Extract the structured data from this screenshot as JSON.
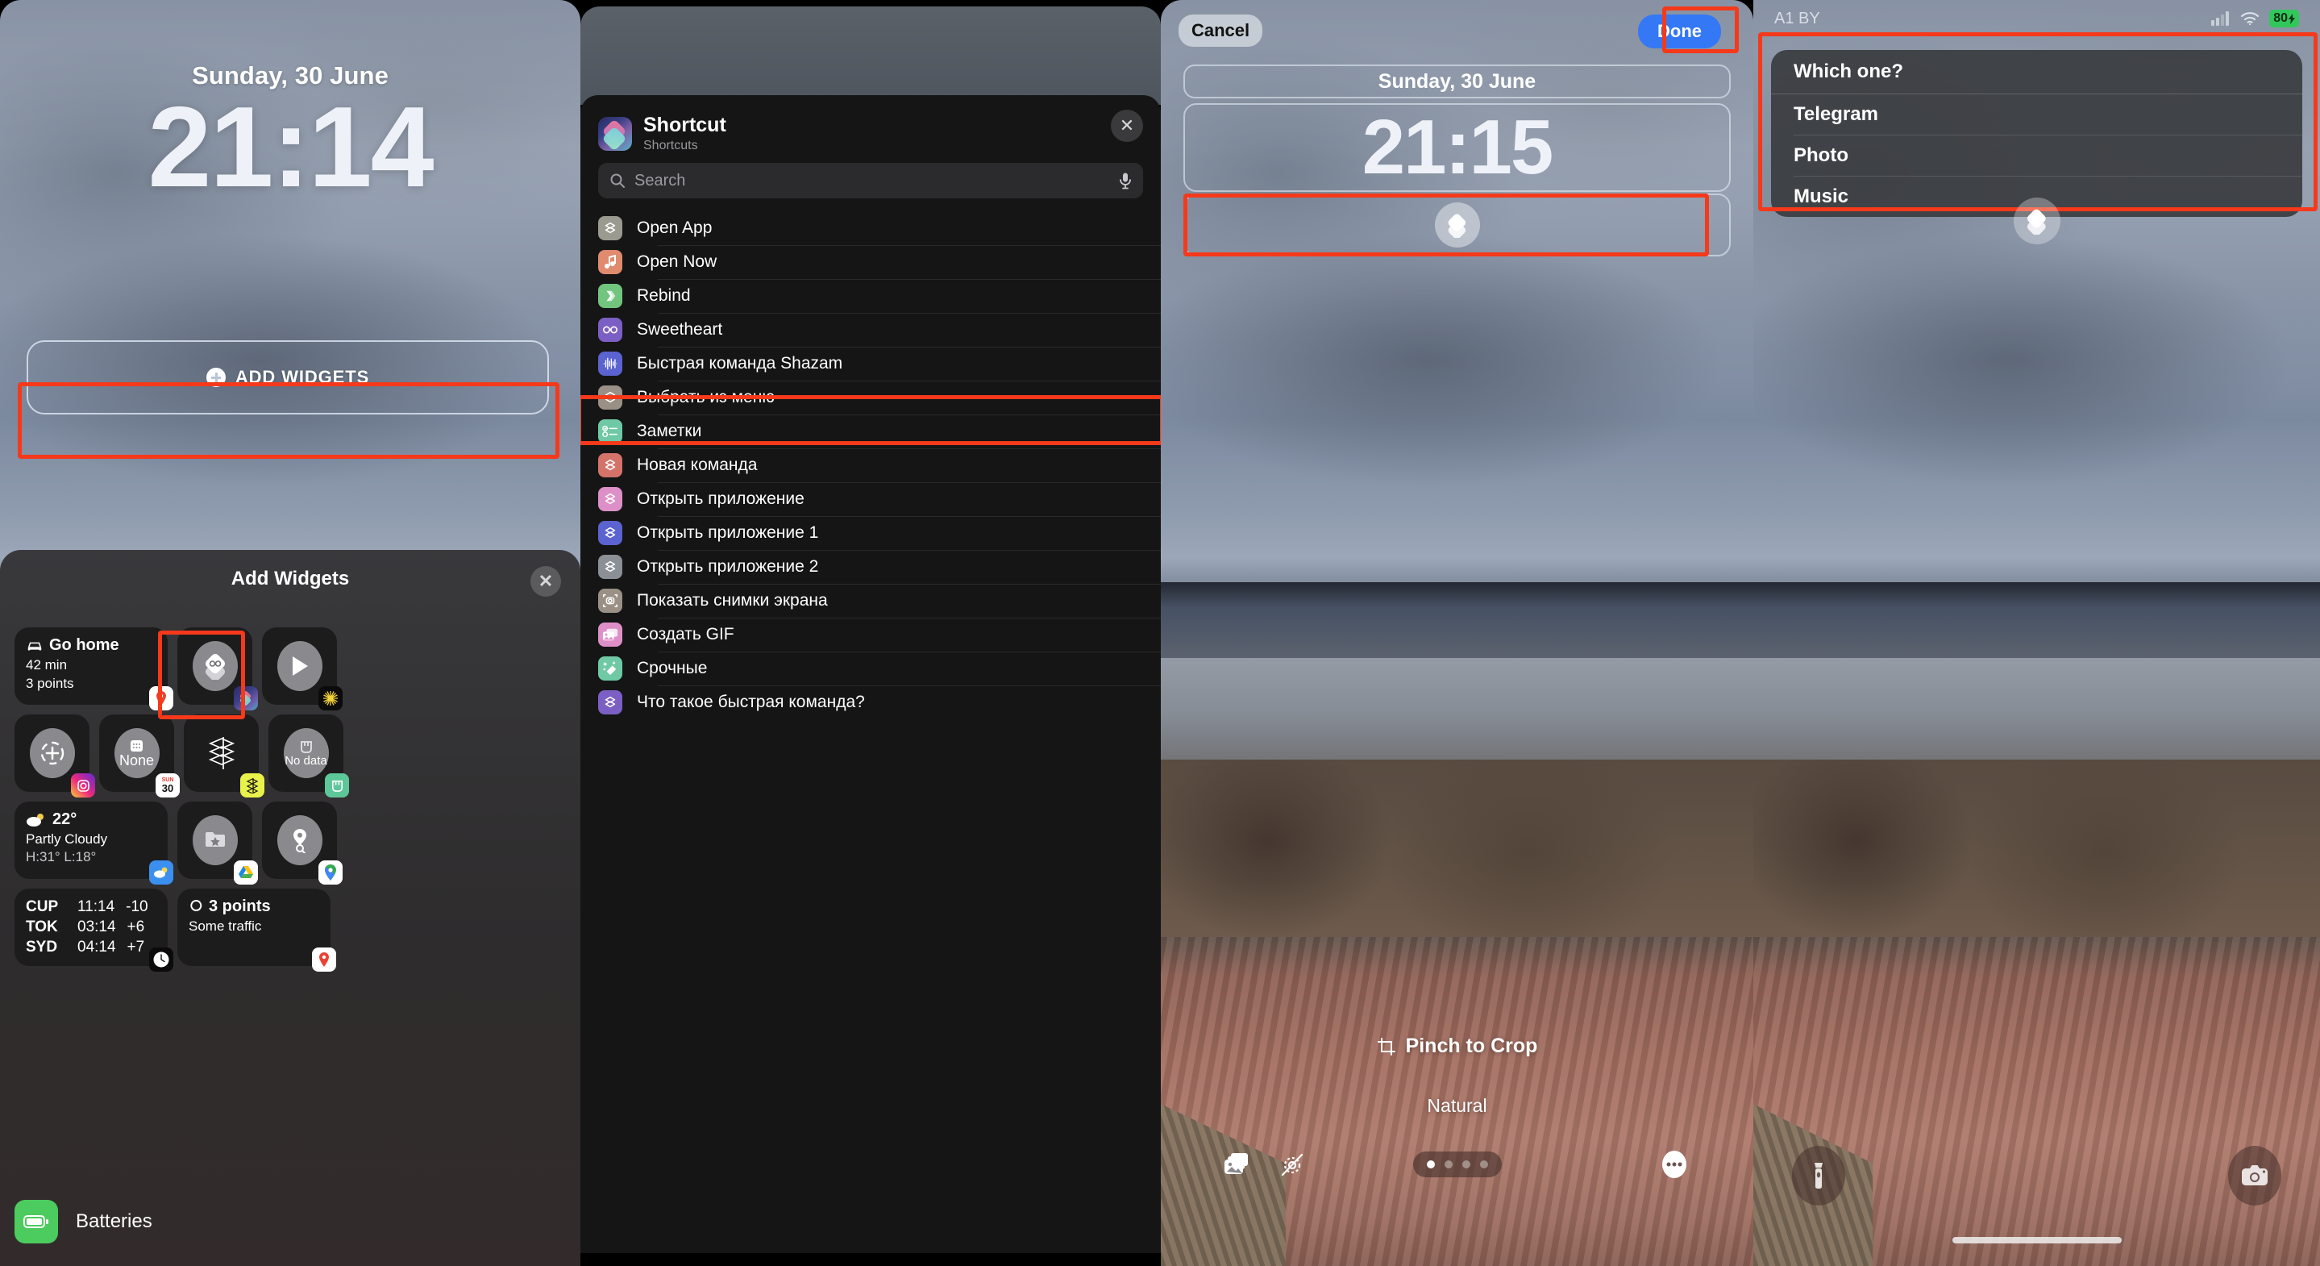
{
  "panel1": {
    "lock_date": "Sunday, 30 June",
    "lock_time": "21:14",
    "add_widgets_label": "ADD WIDGETS",
    "sheet": {
      "title": "Add Widgets",
      "close_label": "✕",
      "widgets": [
        {
          "id": "go-home",
          "type": "wide",
          "title": "Go home",
          "line2": "42 min",
          "line3": "3 points",
          "badge": "maps-pin-icon"
        },
        {
          "id": "shortcut-menu",
          "type": "small",
          "icon": "shortcuts-stack-glasses-icon",
          "badge": "shortcuts-app-icon",
          "highlighted": true
        },
        {
          "id": "shortcut-run",
          "type": "small",
          "icon": "play-icon",
          "badge": "spark-icon"
        },
        {
          "id": "instagram-add",
          "type": "small",
          "icon": "dashed-plus-icon",
          "badge": "instagram-icon"
        },
        {
          "id": "calendar-none",
          "type": "small",
          "icon": "calendar-icon",
          "label": "None",
          "badge": "calendar-sun30-icon"
        },
        {
          "id": "shortcuts-stack",
          "type": "small",
          "icon": "stack-layers-icon",
          "badge": "yellow-stack-icon"
        },
        {
          "id": "mi-no-data",
          "type": "small",
          "icon": "mi-home-icon",
          "label": "No data",
          "badge": "mi-home-green-icon"
        },
        {
          "id": "weather",
          "type": "wide",
          "title": "22°",
          "line2": "Partly Cloudy",
          "line3": "H:31° L:18°",
          "badge": "weather-icon"
        },
        {
          "id": "drive-starred",
          "type": "small",
          "icon": "folder-star-icon",
          "badge": "google-drive-icon"
        },
        {
          "id": "maps-search",
          "type": "small",
          "icon": "pin-search-icon",
          "badge": "google-maps-icon"
        },
        {
          "id": "world-clock",
          "type": "wide",
          "rows": [
            {
              "city": "CUP",
              "time": "11:14",
              "offset": "-10"
            },
            {
              "city": "TOK",
              "time": "03:14",
              "offset": "+6"
            },
            {
              "city": "SYD",
              "time": "04:14",
              "offset": "+7"
            }
          ],
          "badge": "clock-icon"
        },
        {
          "id": "traffic",
          "type": "wide",
          "title": "3 points",
          "line2": "Some traffic",
          "badge": "maps-pin-icon"
        }
      ],
      "batteries_label": "Batteries"
    }
  },
  "panel2": {
    "app_name": "Shortcut",
    "app_subtitle": "Shortcuts",
    "close_label": "✕",
    "search_placeholder": "Search",
    "shortcuts": [
      {
        "label": "Open App",
        "color": "#9a9a90"
      },
      {
        "label": "Open Now",
        "color": "#e08a6e",
        "highlighted": true
      },
      {
        "label": "Rebind",
        "color": "#72c57f"
      },
      {
        "label": "Sweetheart",
        "color": "#7c5fc4"
      },
      {
        "label": "Быстрая команда Shazam",
        "color": "#5a63cf"
      },
      {
        "label": "Выбрать из меню",
        "color": "#9a9086"
      },
      {
        "label": "Заметки",
        "color": "#6fc9a4"
      },
      {
        "label": "Новая команда",
        "color": "#d4736a"
      },
      {
        "label": "Открыть приложение",
        "color": "#dd8fc8"
      },
      {
        "label": "Открыть приложение 1",
        "color": "#5a63cf"
      },
      {
        "label": "Открыть приложение 2",
        "color": "#8b8f96"
      },
      {
        "label": "Показать снимки экрана",
        "color": "#9a9086"
      },
      {
        "label": "Создать GIF",
        "color": "#dd8fc8"
      },
      {
        "label": "Срочные",
        "color": "#6fc9a4"
      },
      {
        "label": "Что такое быстрая команда?",
        "color": "#7c5fc4"
      }
    ]
  },
  "panel3": {
    "cancel_label": "Cancel",
    "done_label": "Done",
    "lock_date": "Sunday, 30 June",
    "lock_time": "21:15",
    "pinch_label": "Pinch to Crop",
    "style_label": "Natural",
    "page_dots": 4,
    "active_dot": 0
  },
  "panel4": {
    "carrier": "A1 BY",
    "battery": "80",
    "menu": {
      "title": "Which one?",
      "options": [
        "Telegram",
        "Photo",
        "Music"
      ]
    }
  },
  "accent": {
    "highlight": "#f5391a",
    "done_blue": "#3478f6",
    "battery_green": "#32c75a"
  }
}
